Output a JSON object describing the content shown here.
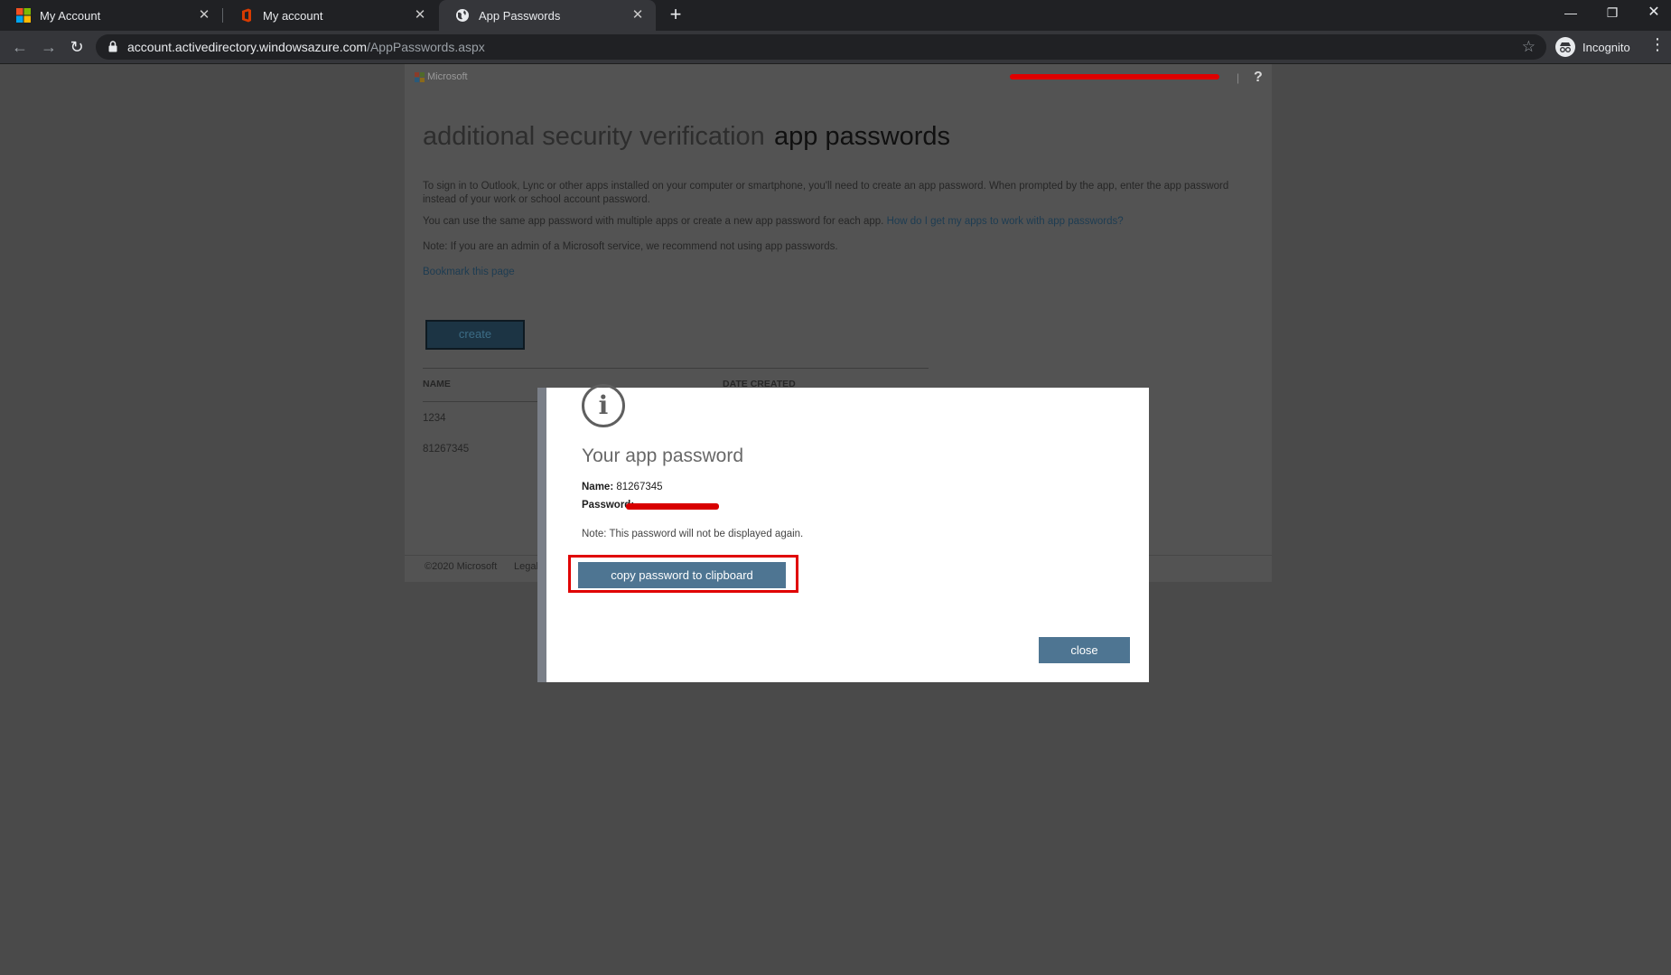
{
  "browser": {
    "tabs": [
      {
        "title": "My Account",
        "icon": "microsoft-logo-icon"
      },
      {
        "title": "My account",
        "icon": "office-logo-icon"
      },
      {
        "title": "App Passwords",
        "icon": "globe-icon"
      }
    ],
    "url_host": "account.activedirectory.windowsazure.com",
    "url_path": "/AppPasswords.aspx",
    "incognito_label": "Incognito"
  },
  "header": {
    "brand": "Microsoft",
    "help": "?"
  },
  "page": {
    "title_section": "additional security verification",
    "title_active": "app passwords",
    "intro": "To sign in to Outlook, Lync or other apps installed on your computer or smartphone, you'll need to create an app password. When prompted by the app, enter the app password instead of your work or school account password.",
    "multi_text": "You can use the same app password with multiple apps or create a new app password for each app.",
    "multi_link": "How do I get my apps to work with app passwords?",
    "admin_note": "Note: If you are an admin of a Microsoft service, we recommend not using app passwords.",
    "bookmark_link": "Bookmark this page",
    "create_label": "create",
    "table": {
      "col_name": "NAME",
      "col_date": "DATE CREATED",
      "rows": [
        "1234",
        "81267345"
      ]
    }
  },
  "footer": {
    "copyright": "©2020 Microsoft",
    "legal": "Legal"
  },
  "dialog": {
    "title": "Your app password",
    "name_label": "Name:",
    "name_value": "81267345",
    "password_label": "Password:",
    "note": "Note: This password will not be displayed again.",
    "copy_button": "copy password to clipboard",
    "close_button": "close"
  }
}
